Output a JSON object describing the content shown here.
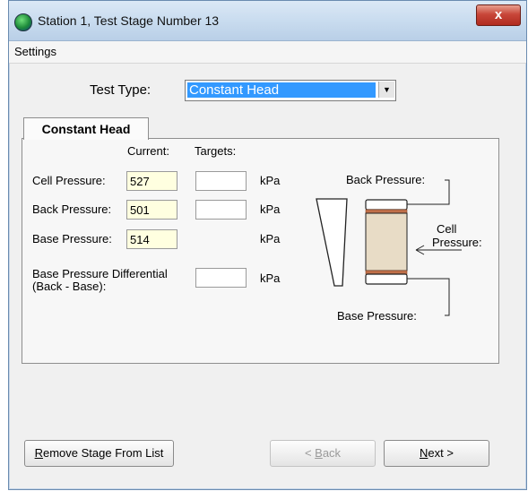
{
  "window": {
    "title": "Station 1, Test Stage Number 13",
    "close_glyph": "x"
  },
  "menu": {
    "settings": "Settings"
  },
  "test_type": {
    "label": "Test Type:",
    "selected": "Constant Head"
  },
  "tab": {
    "label": "Constant Head"
  },
  "columns": {
    "current": "Current:",
    "targets": "Targets:"
  },
  "rows": {
    "cell": {
      "label": "Cell Pressure:",
      "current": "527",
      "target": "",
      "unit": "kPa"
    },
    "back": {
      "label": "Back Pressure:",
      "current": "501",
      "target": "",
      "unit": "kPa"
    },
    "base": {
      "label": "Base Pressure:",
      "current": "514",
      "unit": "kPa"
    },
    "diff": {
      "label_line1": "Base Pressure Differential",
      "label_line2": "(Back - Base):",
      "target": "",
      "unit": "kPa"
    }
  },
  "diagram": {
    "back_pressure": "Back Pressure:",
    "cell_line1": "Cell",
    "cell_line2": "Pressure:",
    "base_pressure": "Base Pressure:"
  },
  "buttons": {
    "remove": {
      "mnemonic": "R",
      "rest": "emove Stage From List"
    },
    "back": {
      "prefix": "< ",
      "mnemonic": "B",
      "rest": "ack"
    },
    "next": {
      "mnemonic": "N",
      "rest": "ext >"
    }
  },
  "colors": {
    "title_gradient_top": "#dbe8f6",
    "selection_blue": "#3399ff",
    "current_field_bg": "#ffffe0",
    "sample_fill": "#e8dcc6",
    "porous_stone": "#c0704a"
  }
}
